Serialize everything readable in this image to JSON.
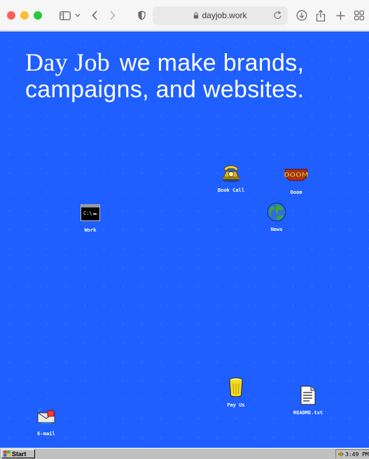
{
  "browser": {
    "url": "dayjob.work",
    "icons": [
      "close-light",
      "minimize-light",
      "zoom-light",
      "sidebar-icon",
      "chevron-down-icon",
      "back-icon",
      "forward-icon",
      "shield-icon",
      "lock-icon",
      "reload-icon",
      "download-icon",
      "share-icon",
      "new-tab-icon",
      "tab-overview-icon"
    ]
  },
  "hero": {
    "brand": "Day Job",
    "tagline": "we make brands, campaigns, and websites."
  },
  "desktop": {
    "background": "#1f5fff",
    "icons": [
      {
        "label": "Book Call",
        "icon": "telephone-icon"
      },
      {
        "label": "Doom",
        "icon": "doom-icon"
      },
      {
        "label": "Work",
        "icon": "command-prompt-icon"
      },
      {
        "label": "News",
        "icon": "globe-icon"
      },
      {
        "label": "Pay Us",
        "icon": "trash-can-icon"
      },
      {
        "label": "README.txt",
        "icon": "text-file-icon"
      },
      {
        "label": "E-mail",
        "icon": "email-icon"
      }
    ]
  },
  "taskbar": {
    "start_label": "Start",
    "clock": "3:49 PM"
  }
}
